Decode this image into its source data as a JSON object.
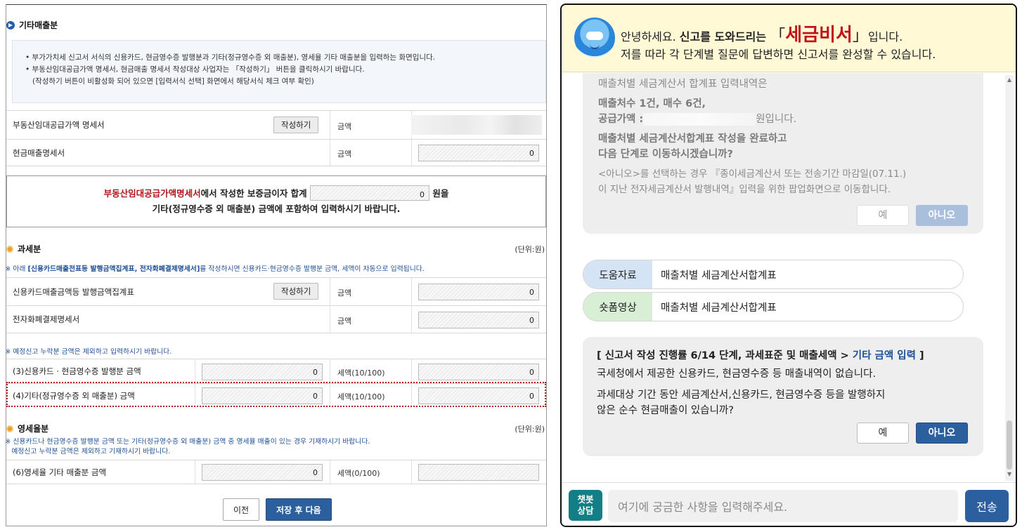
{
  "form": {
    "sections": {
      "etc_sales": "기타매출분",
      "taxable": "과세분",
      "zero_rate": "영세율분",
      "unit": "(단위:원)"
    },
    "info_lines": [
      "• 부가가치세 신고서 서식의 신용카드, 현금영수증 발행분과 기타(정규영수증 외 매출분), 영세율 기타 매출분을 입력하는 화면입니다.",
      "• 부동산임대공급가액 명세서, 현금매출 명세서 작성대상 사업자는 「작성하기」 버튼을 클릭하시기 바랍니다.",
      "   (작성하기 버튼이 비활성화 되어 있으면 [입력서식 선택] 화면에서 해당서식 체크 여부 확인)"
    ],
    "write_button": "작성하기",
    "amount_label": "금액",
    "rows": {
      "realestate_label": "부동산임대공급가액 명세서",
      "cash_sales_label": "현금매출명세서",
      "cash_sales_value": "0",
      "card_summary_label": "신용카드매출금액등 발행금액집계표",
      "card_summary_value": "0",
      "epay_label": "전자화폐결제명세서",
      "epay_value": "0",
      "r3_label": "(3)신용카드 · 현금영수증 발행분 금액",
      "r3_value": "0",
      "r3_tax_label": "세액(10/100)",
      "r3_tax_value": "0",
      "r4_label": "(4)기타(정규영수증 외 매출분) 금액",
      "r4_value": "0",
      "r4_tax_label": "세액(10/100)",
      "r4_tax_value": "0",
      "r6_label": "(6)영세율 기타 매출분 금액",
      "r6_value": "0",
      "r6_tax_label": "세액(0/100)"
    },
    "notice": {
      "red": "부동산임대공급가액명세서",
      "mid": "에서 작성한 보증금이자 합계",
      "value": "0",
      "after": "원을",
      "line2": "기타(정규영수증 외 매출분) 금액에 포함하여 입력하시기 바랍니다."
    },
    "notes": {
      "taxable_prefix": "※ 아래 ",
      "taxable_bold": "[신용카드매출전표등 발행금액집계표, 전자화폐결제명세서]",
      "taxable_suffix": "를 작성하시면 신용카드·현금영수증 발행분 금액, 세액이 자동으로 입력됩니다.",
      "exclude_late": "※ 예정신고 누락분 금액은 제외하고 입력하시기 바랍니다.",
      "zero_line1": "※ 신용카드나 현금영수증 발행분 금액 또는 기타(정규영수증 외 매출분) 금액 중 영세율 매출이 있는 경우 기재하시기 바랍니다.",
      "zero_line2": "   예정신고 누락분 금액은 제외하고 기재하시기 바랍니다."
    },
    "prev_button": "이전",
    "next_button": "저장 후 다음"
  },
  "chat": {
    "header": {
      "greet": "안녕하세요. ",
      "bold": "신고를 도와드리는",
      "lbr": "「",
      "brand": "세금비서",
      "rbr": "」",
      "tail": "입니다.",
      "line2": "저를 따라 각 단계별 질문에 답변하면 신고서를 완성할 수 있습니다."
    },
    "old_bubble": {
      "l1": "매출처별 세금계산서 합계표 입력내역은",
      "l2": "매출처수 1건, 매수 6건,",
      "l3a": "공급가액 :",
      "l3b": "원입니다.",
      "l4": "매출처별 세금계산서합계표 작성을 완료하고",
      "l5": "다음 단계로 이동하시겠습니까?",
      "l6": "<아니오>를 선택하는 경우 『종이세금계산서 또는 전송기간 마감일(07.11.)",
      "l7": "이 지난 전자세금계산서 발행내역』입력을 위한 팝업화면으로 이동합니다.",
      "yes": "예",
      "no": "아니오"
    },
    "links": [
      {
        "tag": "도움자료",
        "text": "매출처별 세금계산서합계표"
      },
      {
        "tag": "숏폼영상",
        "text": "매출처별 세금계산서합계표"
      }
    ],
    "current": {
      "title_a": "[ 신고서 작성 진행률 6/14 단계, 과세표준 및 매출세액 > ",
      "title_hl": "기타 금액 입력",
      "title_b": " ]",
      "p1": "국세청에서 제공한 신용카드, 현금영수증 등 매출내역이 없습니다.",
      "p2a": "과세대상 기간 동안 세금계산서,신용카드, 현금영수증 등을 발행하지",
      "p2b": "않은 순수 현금매출이 있습니까?",
      "yes": "예",
      "no": "아니오"
    },
    "input": {
      "badge_line1": "챗봇",
      "badge_line2": "상담",
      "placeholder": "여기에 궁금한 사항을 입력해주세요.",
      "send": "전송"
    }
  },
  "colors": {
    "primary_blue": "#2c5f9e",
    "brand_red": "#c0141a",
    "header_yellow": "#fff9d6",
    "chatbot_teal": "#127e85"
  }
}
